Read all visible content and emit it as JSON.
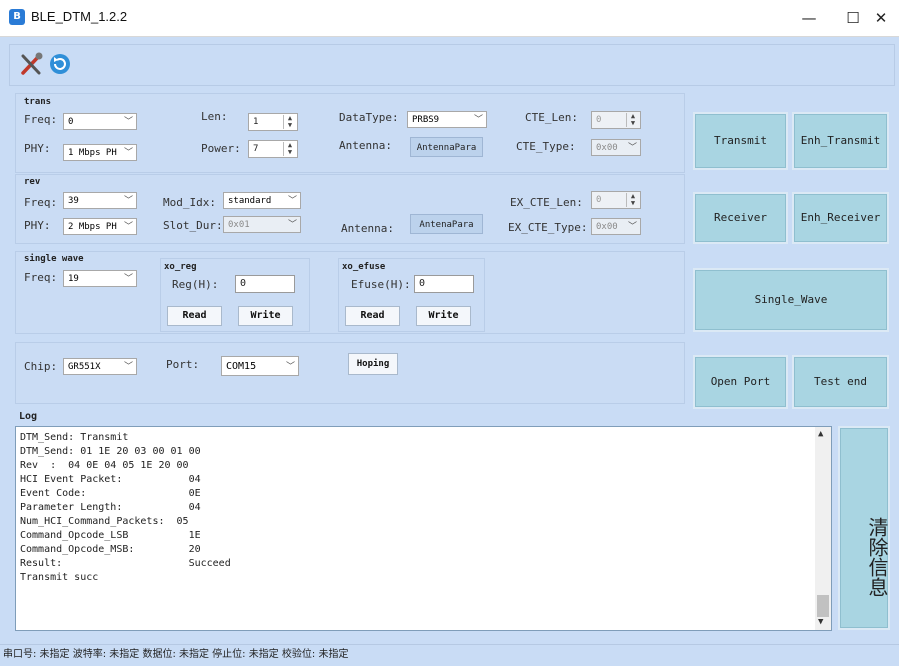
{
  "window": {
    "title": "BLE_DTM_1.2.2",
    "minimize": "—",
    "maximize": "☐",
    "close": "✕"
  },
  "trans": {
    "group_label": "trans",
    "freq_label": "Freq:",
    "freq_value": "0",
    "len_label": "Len:",
    "len_value": "1",
    "datatype_label": "DataType:",
    "datatype_value": "PRBS9",
    "cte_len_label": "CTE_Len:",
    "cte_len_value": "0",
    "phy_label": "PHY:",
    "phy_value": "1 Mbps PH",
    "power_label": "Power:",
    "power_value": "7",
    "antenna_label": "Antenna:",
    "antenna_button": "AntennaPara",
    "cte_type_label": "CTE_Type:",
    "cte_type_value": "0x00",
    "transmit_button": "Transmit",
    "enh_transmit_button": "Enh_Transmit"
  },
  "rev": {
    "group_label": "rev",
    "freq_label": "Freq:",
    "freq_value": "39",
    "mod_idx_label": "Mod_Idx:",
    "mod_idx_value": "standard",
    "ex_cte_len_label": "EX_CTE_Len:",
    "ex_cte_len_value": "0",
    "phy_label": "PHY:",
    "phy_value": "2 Mbps PH",
    "slot_dur_label": "Slot_Dur:",
    "slot_dur_value": "0x01",
    "antenna_label": "Antenna:",
    "antenna_button": "AntenaPara",
    "ex_cte_type_label": "EX_CTE_Type:",
    "ex_cte_type_value": "0x00",
    "receiver_button": "Receiver",
    "enh_receiver_button": "Enh_Receiver"
  },
  "single_wave": {
    "group_label": "single wave",
    "freq_label": "Freq:",
    "freq_value": "19",
    "xo_reg_label": "xo_reg",
    "reg_label": "Reg(H):",
    "reg_value": "0",
    "reg_read": "Read",
    "reg_write": "Write",
    "xo_efuse_label": "xo_efuse",
    "efuse_label": "Efuse(H):",
    "efuse_value": "0",
    "efuse_read": "Read",
    "efuse_write": "Write",
    "single_wave_button": "Single_Wave"
  },
  "chip": {
    "chip_label": "Chip:",
    "chip_value": "GR551X",
    "port_label": "Port:",
    "port_value": "COM15",
    "hoping_button": "Hoping",
    "open_port_button": "Open Port",
    "test_end_button": "Test end"
  },
  "log": {
    "label": "Log",
    "lines": "DTM_Send: Transmit\nDTM_Send: 01 1E 20 03 00 01 00\nRev  :  04 0E 04 05 1E 20 00\nHCI Event Packet:           04\nEvent Code:                 0E\nParameter Length:           04\nNum_HCI_Command_Packets:  05\nCommand_Opcode_LSB          1E\nCommand_Opcode_MSB:         20\nResult:                     Succeed\nTransmit succ",
    "clear_button": "清除信息"
  },
  "statusbar": {
    "text": "串口号: 未指定  波特率: 未指定  数据位: 未指定  停止位: 未指定  校验位: 未指定"
  },
  "icons": {
    "tool": "tools-icon",
    "refresh": "refresh-icon"
  }
}
